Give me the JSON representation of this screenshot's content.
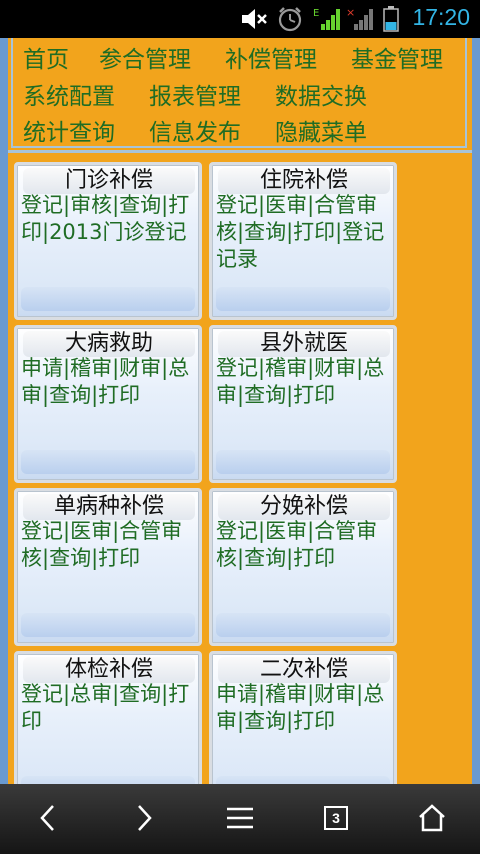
{
  "status_bar": {
    "time": "17:20",
    "icons": [
      "mute-icon",
      "alarm-icon",
      "signal-icon",
      "signal-icon",
      "battery-icon"
    ]
  },
  "nav_menu": {
    "items": [
      "首页",
      "参合管理",
      "补偿管理",
      "基金管理",
      "系统配置",
      "报表管理",
      "数据交换",
      "统计查询",
      "信息发布",
      "隐藏菜单"
    ]
  },
  "cards": [
    {
      "title": "门诊补偿",
      "desc": "登记|审核|查询|打印|2013门诊登记"
    },
    {
      "title": "住院补偿",
      "desc": "登记|医审|合管审核|查询|打印|登记记录"
    },
    {
      "title": "大病救助",
      "desc": "申请|稽审|财审|总审|查询|打印"
    },
    {
      "title": "县外就医",
      "desc": "登记|稽审|财审|总审|查询|打印"
    },
    {
      "title": "单病种补偿",
      "desc": "登记|医审|合管审核|查询|打印"
    },
    {
      "title": "分娩补偿",
      "desc": "登记|医审|合管审核|查询|打印"
    },
    {
      "title": "体检补偿",
      "desc": "登记|总审|查询|打印"
    },
    {
      "title": "二次补偿",
      "desc": "申请|稽审|财审|总审|查询|打印"
    }
  ],
  "bottom_bar": {
    "tab_count": "3",
    "buttons": [
      "back-icon",
      "forward-icon",
      "menu-icon",
      "tabs-icon",
      "home-icon"
    ]
  },
  "colors": {
    "page_bg": "#f2a41c",
    "menu_text": "#1f6c24",
    "status_accent": "#33b5e5"
  }
}
